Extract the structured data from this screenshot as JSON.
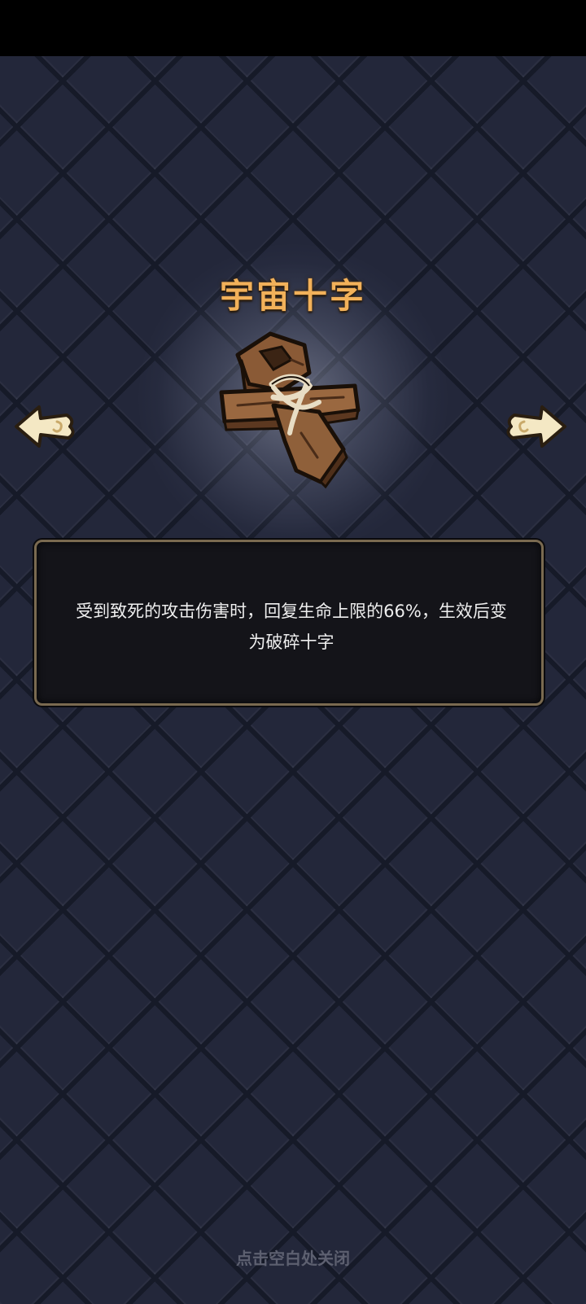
{
  "item": {
    "title": "宇宙十字",
    "description": "受到致死的攻击伤害时，回复生命上限的66%，生效后变为破碎十字",
    "icon": "wooden-cross-icon"
  },
  "nav": {
    "prev_icon": "arrow-left-icon",
    "next_icon": "arrow-right-icon"
  },
  "footer": {
    "close_hint": "点击空白处关闭"
  },
  "colors": {
    "title": "#f2b15a",
    "panel_border": "#7a6a50",
    "background": "#23273a"
  }
}
